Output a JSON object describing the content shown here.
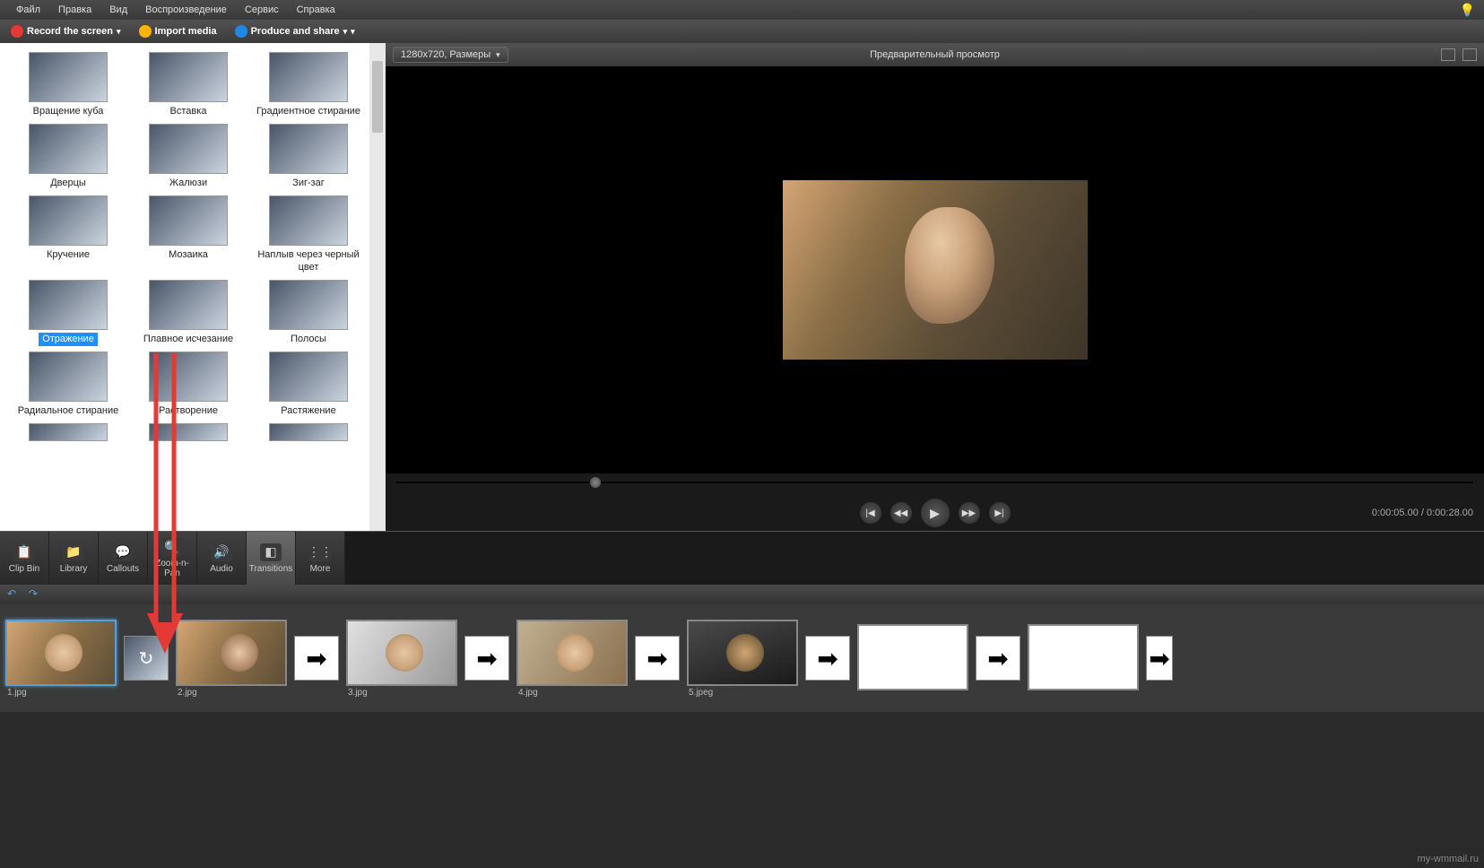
{
  "menubar": {
    "items": [
      "Файл",
      "Правка",
      "Вид",
      "Воспроизведение",
      "Сервис",
      "Справка"
    ]
  },
  "toolbar": {
    "record": "Record the screen",
    "import": "Import media",
    "produce": "Produce and share"
  },
  "transitions": {
    "items": [
      {
        "label": "Вращение куба",
        "selected": false
      },
      {
        "label": "Вставка",
        "selected": false
      },
      {
        "label": "Градиентное стирание",
        "selected": false
      },
      {
        "label": "Дверцы",
        "selected": false
      },
      {
        "label": "Жалюзи",
        "selected": false
      },
      {
        "label": "Зиг-заг",
        "selected": false
      },
      {
        "label": "Кручение",
        "selected": false
      },
      {
        "label": "Мозаика",
        "selected": false
      },
      {
        "label": "Наплыв через черный цвет",
        "selected": false
      },
      {
        "label": "Отражение",
        "selected": true
      },
      {
        "label": "Плавное исчезание",
        "selected": false
      },
      {
        "label": "Полосы",
        "selected": false
      },
      {
        "label": "Радиальное стирание",
        "selected": false
      },
      {
        "label": "Растворение",
        "selected": false
      },
      {
        "label": "Растяжение",
        "selected": false
      }
    ]
  },
  "preview": {
    "resolution": "1280x720, Размеры",
    "title": "Предварительный просмотр",
    "current_time": "0:00:05.00",
    "total_time": "0:00:28.00"
  },
  "tool_tabs": {
    "items": [
      {
        "label": "Clip Bin",
        "icon": "📋"
      },
      {
        "label": "Library",
        "icon": "📁"
      },
      {
        "label": "Callouts",
        "icon": "💬"
      },
      {
        "label": "Zoom-n-Pan",
        "icon": "🔍"
      },
      {
        "label": "Audio",
        "icon": "🔊"
      },
      {
        "label": "Transitions",
        "icon": "◧"
      },
      {
        "label": "More",
        "icon": "⋮⋮"
      }
    ],
    "active_index": 5
  },
  "timeline": {
    "clips": [
      {
        "label": "1.jpg",
        "active": true,
        "cls": ""
      },
      {
        "label": "2.jpg",
        "active": false,
        "cls": "p2"
      },
      {
        "label": "3.jpg",
        "active": false,
        "cls": "p3"
      },
      {
        "label": "4.jpg",
        "active": false,
        "cls": "p4"
      },
      {
        "label": "5.jpeg",
        "active": false,
        "cls": "p5"
      },
      {
        "label": "",
        "active": false,
        "cls": "blank"
      },
      {
        "label": "",
        "active": false,
        "cls": "blank"
      }
    ],
    "transition_applied_index": 0
  },
  "watermark": "my-wmmail.ru"
}
